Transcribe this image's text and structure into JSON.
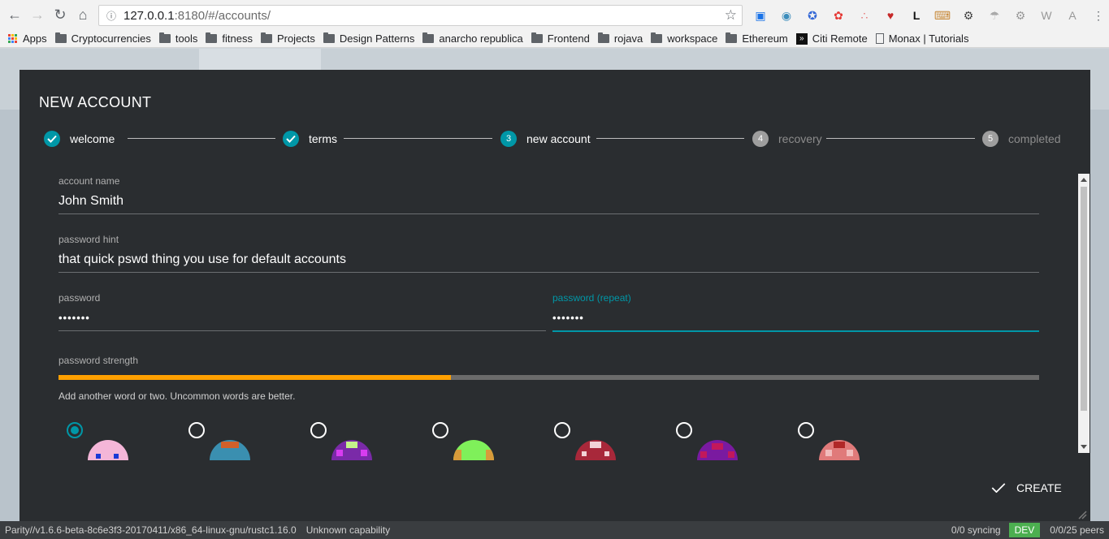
{
  "browser": {
    "url_host": "127.0.0.1",
    "url_rest": ":8180/#/accounts/",
    "bookmarks": [
      "Apps",
      "Cryptocurrencies",
      "tools",
      "fitness",
      "Projects",
      "Design Patterns",
      "anarcho republica",
      "Frontend",
      "rojava",
      "workspace",
      "Ethereum",
      "Citi Remote",
      "Monax | Tutorials"
    ]
  },
  "modal": {
    "title": "NEW ACCOUNT",
    "steps": [
      {
        "num": "1",
        "label": "welcome",
        "state": "done"
      },
      {
        "num": "2",
        "label": "terms",
        "state": "done"
      },
      {
        "num": "3",
        "label": "new account",
        "state": "active"
      },
      {
        "num": "4",
        "label": "recovery",
        "state": "pending"
      },
      {
        "num": "5",
        "label": "completed",
        "state": "pending"
      }
    ],
    "fields": {
      "account_name": {
        "label": "account name",
        "value": "John Smith"
      },
      "password_hint": {
        "label": "password hint",
        "value": "that quick pswd thing you use for default accounts"
      },
      "password": {
        "label": "password",
        "value": "•••••••"
      },
      "password_repeat": {
        "label": "password (repeat)",
        "value": "•••••••"
      }
    },
    "strength": {
      "label": "password strength",
      "fraction": 0.4,
      "message": "Add another word or two. Uncommon words are better."
    },
    "identicons_selected_index": 0,
    "create_label": "CREATE"
  },
  "status": {
    "version": "Parity//v1.6.6-beta-8c6e3f3-20170411/x86_64-linux-gnu/rustc1.16.0",
    "capability": "Unknown capability",
    "syncing": "0/0 syncing",
    "badge": "DEV",
    "peers": "0/0/25 peers"
  },
  "colors": {
    "accent": "#0097a7",
    "strength": "#ffa000",
    "dev_badge": "#4caf50",
    "modal_bg": "#2a2d30"
  }
}
